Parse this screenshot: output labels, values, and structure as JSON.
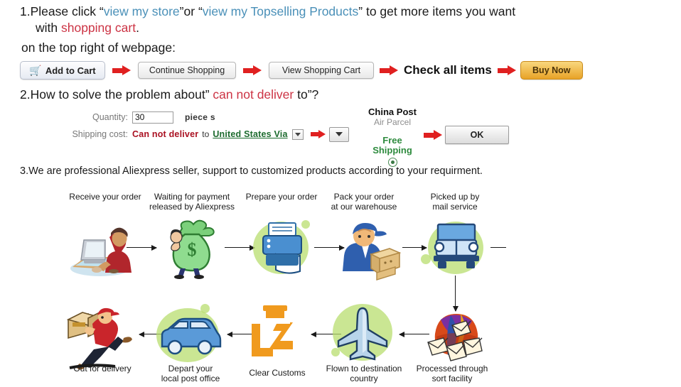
{
  "instructions": {
    "step1": {
      "number": "1.",
      "part_a": "Please click ",
      "quote_open": "“",
      "link1": "view my store",
      "quote_close": "”",
      "between": "or ",
      "link2": "view my Topselling Products",
      "part_b": " to get  more items you want",
      "line2_a": "with ",
      "line2_highlight": "shopping cart",
      "line2_b": ".",
      "line3": "on the top right of webpage:"
    },
    "step2": {
      "number": "2.",
      "text_a": "How to solve the problem about” ",
      "highlight": "can not deliver",
      "text_b": " to”?"
    },
    "step3": {
      "number": "3",
      "text": ".We are professional Aliexpress seller, support to customized products according to your requirment."
    }
  },
  "button_row": {
    "add_to_cart": "Add to Cart",
    "cart_icon": "shopping-cart-icon",
    "continue_shopping": "Continue Shopping",
    "view_shopping_cart": "View Shopping Cart",
    "check_all_items": "Check all items",
    "buy_now": "Buy Now"
  },
  "form": {
    "quantity_label": "Quantity:",
    "quantity_value": "30",
    "quantity_unit": "piece s",
    "shipping_label": "Shipping cost:",
    "shipping_status": "Can not deliver",
    "to_word": "to",
    "country_via": "United States Via",
    "dropdown_small_icon": "caret-down-icon",
    "dropdown_large_icon": "caret-down-icon"
  },
  "shipping_option": {
    "carrier_line1": "China Post",
    "carrier_line2": "Air Parcel",
    "free_line1": "Free",
    "free_line2": "Shipping",
    "radio_icon": "radio-selected-icon",
    "ok_button": "OK"
  },
  "flow": {
    "row1": [
      {
        "label": "Receive your order",
        "icon": "person-at-computer-icon"
      },
      {
        "label": "Waiting for payment\nreleased by Aliexpress",
        "icon": "money-bag-icon"
      },
      {
        "label": "Prepare your order",
        "icon": "printer-icon"
      },
      {
        "label": "Pack your order\nat our warehouse",
        "icon": "worker-with-boxes-icon"
      },
      {
        "label": "Picked up by\nmail service",
        "icon": "truck-icon"
      }
    ],
    "row2": [
      {
        "label": "Out for delivery",
        "icon": "running-courier-icon"
      },
      {
        "label": "Depart your\nlocal post office",
        "icon": "blue-van-icon"
      },
      {
        "label": "Clear Customs",
        "icon": "customs-officer-icon"
      },
      {
        "label": "Flown to destination\ncountry",
        "icon": "airplane-icon"
      },
      {
        "label": "Processed through\nsort facility",
        "icon": "mail-sorting-icon"
      }
    ]
  },
  "colors": {
    "link_blue": "#4a90b8",
    "highlight_red": "#cc3344",
    "status_red": "#aa1122",
    "country_green": "#1c6b2e",
    "free_green": "#2e8b3e",
    "arrow_red": "#e02020",
    "buy_now_orange": "#e8a327",
    "blob_green": "#b6dc6a"
  }
}
